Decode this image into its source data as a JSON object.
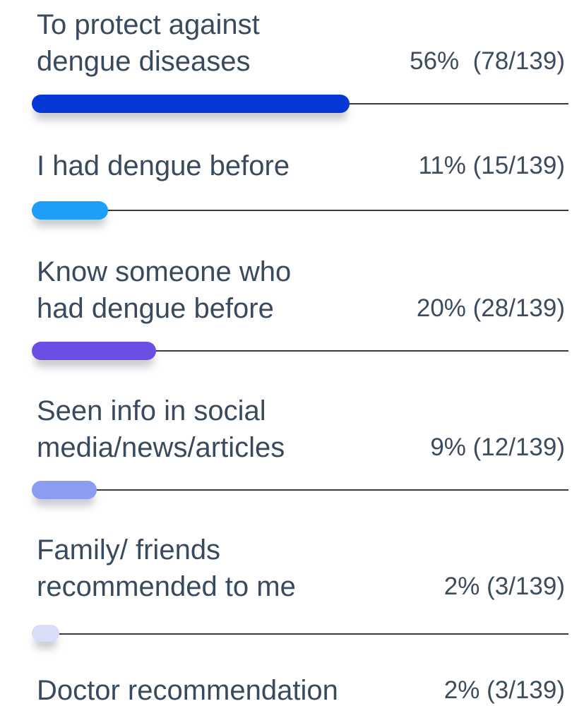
{
  "chart_data": {
    "type": "bar",
    "orientation": "horizontal",
    "categories": [
      "To protect against\ndengue diseases",
      "I had dengue before",
      "Know someone who\nhad dengue before",
      "Seen info in social\nmedia/news/articles",
      "Family/ friends\nrecommended to me",
      "Doctor recommendation"
    ],
    "values": [
      56,
      11,
      20,
      9,
      2,
      2
    ],
    "value_labels": [
      "56%  (78/139)",
      "11% (15/139)",
      "20% (28/139)",
      "9% (12/139)",
      "2% (3/139)",
      "2% (3/139)"
    ],
    "colors": [
      "#0638d8",
      "#1e9ff7",
      "#6b4fe4",
      "#8b9cf1",
      "#d9ddf7"
    ]
  }
}
